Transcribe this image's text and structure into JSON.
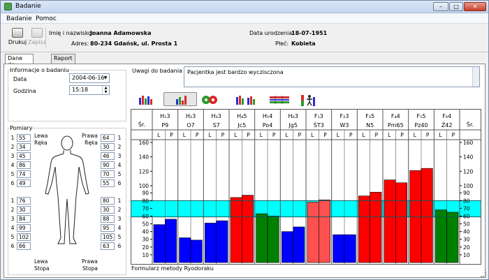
{
  "window": {
    "title": "Badanie"
  },
  "menu": {
    "items": [
      "Badanie",
      "Pomoc"
    ]
  },
  "toolbar": {
    "print_label": "Drukuj",
    "save_label": "Zapisz"
  },
  "patient": {
    "name_label": "Imię i nazwisko:",
    "name": "Joanna Adamowska",
    "address_label": "Adres:",
    "address": "80-234 Gdańsk, ul. Prosta 1",
    "dob_label": "Data urodzenia:",
    "dob": "18-07-1951",
    "sex_label": "Płeć:",
    "sex": "Kobieta"
  },
  "tabs": [
    "Dane do obliczeń",
    "Raport"
  ],
  "info": {
    "title": "Informacje o badaniu",
    "date_label": "Data",
    "date": "2004-06-16",
    "time_label": "Godzina",
    "time": "15:18"
  },
  "measurements": {
    "title": "Pomiary",
    "left_hand_label": "Lewa\nRęka",
    "right_hand_label": "Prawa\nRęka",
    "left_foot_label": "Lewa\nStopa",
    "right_foot_label": "Prawa\nStopa",
    "hand_left": [
      "55",
      "34",
      "45",
      "86",
      "74",
      "49"
    ],
    "hand_right": [
      "64",
      "30",
      "46",
      "90",
      "70",
      "55"
    ],
    "foot_left": [
      "76",
      "30",
      "84",
      "99",
      "102",
      "66"
    ],
    "foot_right": [
      "80",
      "30",
      "88",
      "95",
      "105",
      "63"
    ],
    "numbers": [
      "1",
      "2",
      "3",
      "4",
      "5",
      "6"
    ]
  },
  "notes": {
    "label": "Uwagi do badania",
    "text": "Pacjentka jest bardzo wyczisczona"
  },
  "view_buttons": [
    "bars-view-icon",
    "bars-colored-view-icon",
    "yin-yang-icon",
    "compare-bars-icon",
    "table-view-icon",
    "body-chart-icon"
  ],
  "footer": {
    "text": "Formularz metody Ryodoraku"
  },
  "colors": {
    "blue": "#0000ff",
    "red": "#ff0000",
    "green": "#008000",
    "salmon": "#ff5050",
    "band": "#00ffff"
  },
  "chart_data": {
    "type": "bar",
    "avg_label": "Śr.",
    "groups": [
      {
        "code": "H₁3",
        "point": "P9",
        "color": "blue"
      },
      {
        "code": "H₂3",
        "point": "O7",
        "color": "blue"
      },
      {
        "code": "H₃3",
        "point": "S7",
        "color": "blue"
      },
      {
        "code": "H₄5",
        "point": "Jc5",
        "color": "red"
      },
      {
        "code": "H₅4",
        "point": "Po4",
        "color": "green"
      },
      {
        "code": "H₆3",
        "point": "Jg5",
        "color": "blue"
      },
      {
        "code": "F₁3",
        "point": "ŚT3",
        "color": "salmon"
      },
      {
        "code": "F₂3",
        "point": "W3",
        "color": "blue"
      },
      {
        "code": "F₃5",
        "point": "N5",
        "color": "red"
      },
      {
        "code": "F₄4",
        "point": "Pm65",
        "color": "red"
      },
      {
        "code": "F₅5",
        "point": "Pz40",
        "color": "red"
      },
      {
        "code": "F₆4",
        "point": "Ż42",
        "color": "green"
      }
    ],
    "side_labels": [
      "L",
      "P"
    ],
    "series": [
      {
        "name": "L",
        "values": [
          49,
          32,
          51,
          84,
          63,
          40,
          78,
          36,
          86,
          108,
          121,
          68
        ]
      },
      {
        "name": "P",
        "values": [
          56,
          29,
          54,
          87,
          60,
          46,
          81,
          36,
          91,
          104,
          124,
          65
        ]
      }
    ],
    "yticks": [
      "160",
      "140",
      "120",
      "100",
      "90",
      "80",
      "70",
      "60",
      "50",
      "40",
      "30",
      "20",
      "10"
    ],
    "band": [
      59,
      80
    ],
    "grid": false
  }
}
